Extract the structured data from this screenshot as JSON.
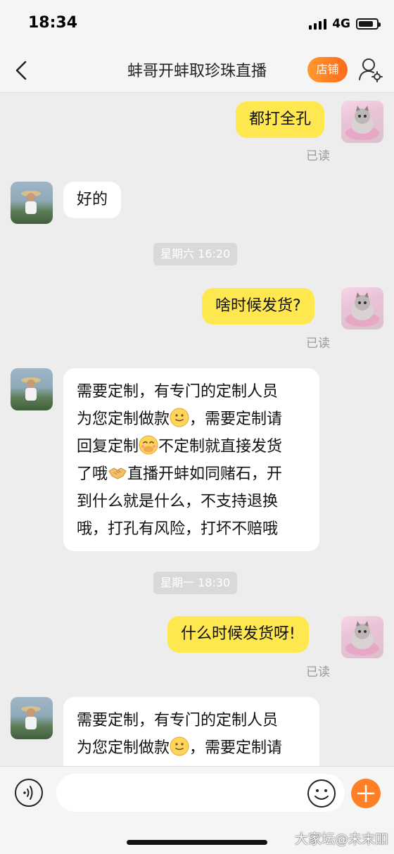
{
  "status_bar": {
    "time": "18:34",
    "network": "4G"
  },
  "nav": {
    "title": "蚌哥开蚌取珍珠直播",
    "shop_label": "店铺"
  },
  "messages": [
    {
      "from": "self",
      "text": "都打全孔",
      "read": "已读"
    },
    {
      "from": "other",
      "text": "好的"
    },
    {
      "divider": "星期六 16:20"
    },
    {
      "from": "self",
      "text": "啥时候发货?",
      "read": "已读"
    },
    {
      "from": "other",
      "lines": [
        "需要定制，有专门的定制人员",
        "为您定制做款",
        "，需要定制请",
        "回复定制",
        "不定制就直接发货",
        "了哦",
        "直播开蚌如同赌石，开",
        "到什么就是什么，不支持退换",
        "哦，打孔有风险，打坏不赔哦"
      ]
    },
    {
      "divider": "星期一 18:30"
    },
    {
      "from": "self",
      "text": "什么时候发货呀!",
      "read": "已读"
    },
    {
      "from": "other",
      "lines": [
        "需要定制，有专门的定制人员",
        "为您定制做款",
        "，需要定制请"
      ]
    }
  ],
  "input": {
    "placeholder": ""
  },
  "watermark": "大家坛@未末吅",
  "colors": {
    "self_bubble": "#ffe74f",
    "other_bubble": "#ffffff",
    "accent": "#ff7f24"
  }
}
